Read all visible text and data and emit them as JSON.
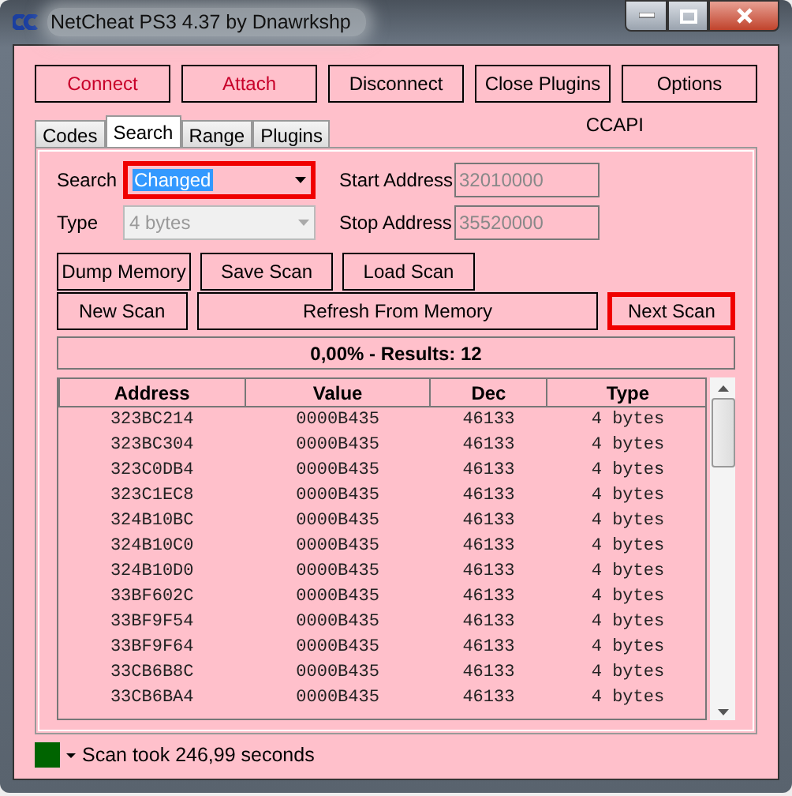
{
  "window": {
    "title": "NetCheat PS3 4.37 by Dnawrkshp"
  },
  "top_buttons": [
    {
      "label": "Connect",
      "color": "#c8002a"
    },
    {
      "label": "Attach",
      "color": "#c8002a"
    },
    {
      "label": "Disconnect",
      "color": "#000000"
    },
    {
      "label": "Close Plugins",
      "color": "#000000"
    },
    {
      "label": "Options",
      "color": "#000000"
    }
  ],
  "tabs": [
    {
      "label": "Codes",
      "selected": false
    },
    {
      "label": "Search",
      "selected": true
    },
    {
      "label": "Range",
      "selected": false
    },
    {
      "label": "Plugins",
      "selected": false
    }
  ],
  "api_label": "CCAPI",
  "search": {
    "label": "Search",
    "value": "Changed",
    "highlighted": true
  },
  "type": {
    "label": "Type",
    "value": "4 bytes",
    "disabled": true
  },
  "start_address": {
    "label": "Start Address",
    "value": "32010000"
  },
  "stop_address": {
    "label": "Stop Address",
    "value": "35520000"
  },
  "buttons_row1": [
    {
      "label": "Dump Memory",
      "highlighted": false
    },
    {
      "label": "Save Scan",
      "highlighted": false
    },
    {
      "label": "Load Scan",
      "highlighted": false
    }
  ],
  "buttons_row2": [
    {
      "label": "New Scan",
      "highlighted": false
    },
    {
      "label": "Refresh From Memory",
      "highlighted": false
    },
    {
      "label": "Next Scan",
      "highlighted": true
    }
  ],
  "results": "0,00% - Results: 12",
  "table": {
    "columns": [
      "Address",
      "Value",
      "Dec",
      "Type"
    ],
    "rows": [
      [
        "323BC214",
        "0000B435",
        "46133",
        "4 bytes"
      ],
      [
        "323BC304",
        "0000B435",
        "46133",
        "4 bytes"
      ],
      [
        "323C0DB4",
        "0000B435",
        "46133",
        "4 bytes"
      ],
      [
        "323C1EC8",
        "0000B435",
        "46133",
        "4 bytes"
      ],
      [
        "324B10BC",
        "0000B435",
        "46133",
        "4 bytes"
      ],
      [
        "324B10C0",
        "0000B435",
        "46133",
        "4 bytes"
      ],
      [
        "324B10D0",
        "0000B435",
        "46133",
        "4 bytes"
      ],
      [
        "33BF602C",
        "0000B435",
        "46133",
        "4 bytes"
      ],
      [
        "33BF9F54",
        "0000B435",
        "46133",
        "4 bytes"
      ],
      [
        "33BF9F64",
        "0000B435",
        "46133",
        "4 bytes"
      ],
      [
        "33CB6B8C",
        "0000B435",
        "46133",
        "4 bytes"
      ],
      [
        "33CB6BA4",
        "0000B435",
        "46133",
        "4 bytes"
      ]
    ]
  },
  "status_bar": {
    "color": "#006400",
    "text": "Scan took 246,99 seconds"
  }
}
